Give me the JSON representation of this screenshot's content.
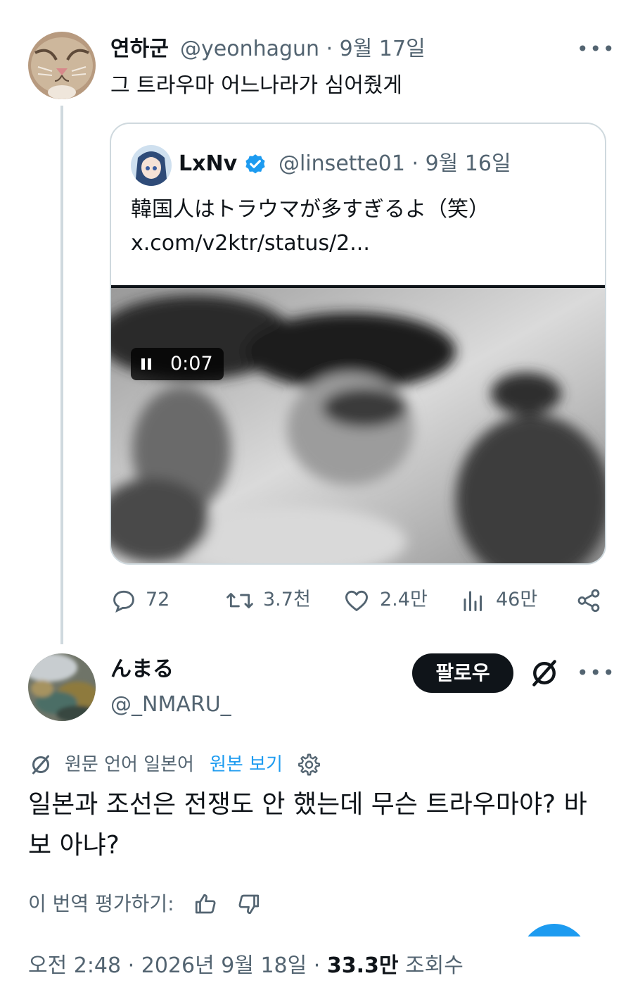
{
  "parent_tweet": {
    "author_name": "연하군",
    "handle": "@yeonhagun",
    "date": "9월 17일",
    "text": "그 트라우마 어느나라가 심어줬게",
    "more_icon": "more-icon"
  },
  "quote": {
    "author_name": "LxNv",
    "verified": true,
    "handle": "@linsette01",
    "date": "9월 16일",
    "text": "韓国人はトラウマが多すぎるよ（笑）",
    "link": "x.com/v2ktr/status/2...",
    "video": {
      "state": "playing",
      "timestamp": "0:07"
    }
  },
  "actions": {
    "replies": "72",
    "reposts": "3.7천",
    "likes": "2.4만",
    "views": "46만",
    "icons": [
      "reply-icon",
      "repost-icon",
      "like-icon",
      "views-icon",
      "share-icon"
    ]
  },
  "reply": {
    "author_name": "んまる",
    "handle": "@_NMARU_",
    "follow_label": "팔로우",
    "translation_note": "원문 언어 일본어",
    "view_original": "원본 보기",
    "translated_text": "일본과 조선은 전쟁도 안 했는데 무슨 트라우마야? 바보 아냐?",
    "rate_label": "이 번역 평가하기:",
    "time": "오전 2:48",
    "date": "2026년 9월 18일",
    "view_count": "33.3만",
    "view_label": "조회수"
  },
  "colors": {
    "text": "#0f1419",
    "secondary": "#536471",
    "link": "#1d9bf0",
    "verified": "#1d9bf0",
    "border": "#cfd9de",
    "follow_button": "#0f1419"
  }
}
